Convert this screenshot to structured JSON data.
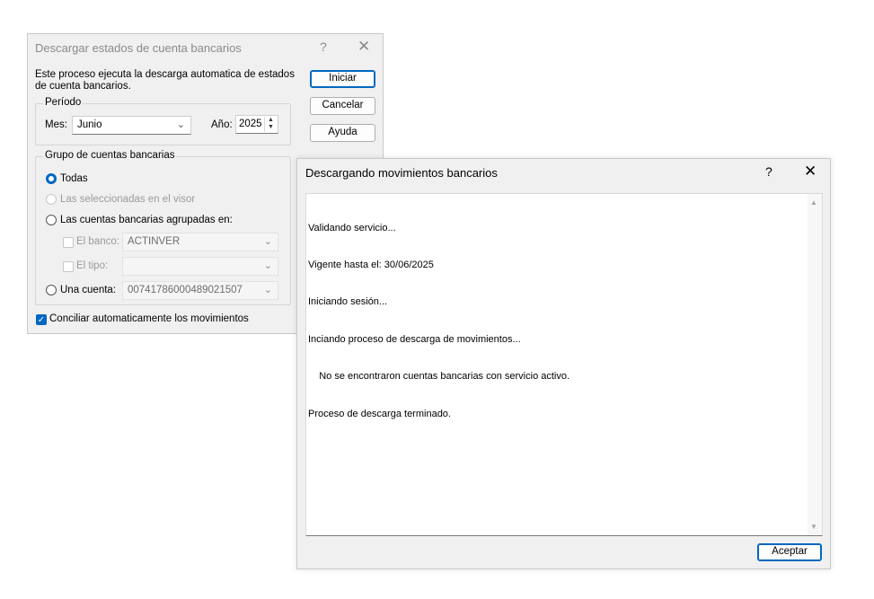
{
  "main_dialog": {
    "title": "Descargar estados de cuenta bancarios",
    "help_glyph": "?",
    "close_glyph": "✕",
    "description": "Este proceso ejecuta la descarga automatica de estados de cuenta bancarios.",
    "buttons": {
      "start": "Iniciar",
      "cancel": "Cancelar",
      "help": "Ayuda"
    },
    "period": {
      "legend": "Período",
      "month_label": "Mes:",
      "month_value": "Junio",
      "year_label": "Año:",
      "year_value": "2025"
    },
    "group": {
      "legend": "Grupo de cuentas bancarias",
      "option_all": "Todas",
      "option_selected": "Las seleccionadas en el visor",
      "option_grouped": "Las  cuentas bancarias agrupadas en:",
      "bank_label": "El banco:",
      "bank_value": "ACTINVER",
      "type_label": "El tipo:",
      "type_value": "",
      "one_account_label": "Una cuenta:",
      "one_account_value": "00741786000489021507"
    },
    "reconcile_label": "Conciliar automaticamente los movimientos"
  },
  "progress_dialog": {
    "title": "Descargando movimientos bancarios",
    "help_glyph": "?",
    "close_glyph": "✕",
    "log": [
      "Validando servicio...",
      "Vigente hasta el: 30/06/2025",
      "Iniciando sesión...",
      "Inciando proceso de descarga de movimientos...",
      "    No se encontraron cuentas bancarias con servicio activo.",
      "Proceso de descarga terminado."
    ],
    "accept_label": "Aceptar"
  },
  "colors": {
    "accent": "#0067c0",
    "dialog_bg": "#f0f0f0"
  }
}
